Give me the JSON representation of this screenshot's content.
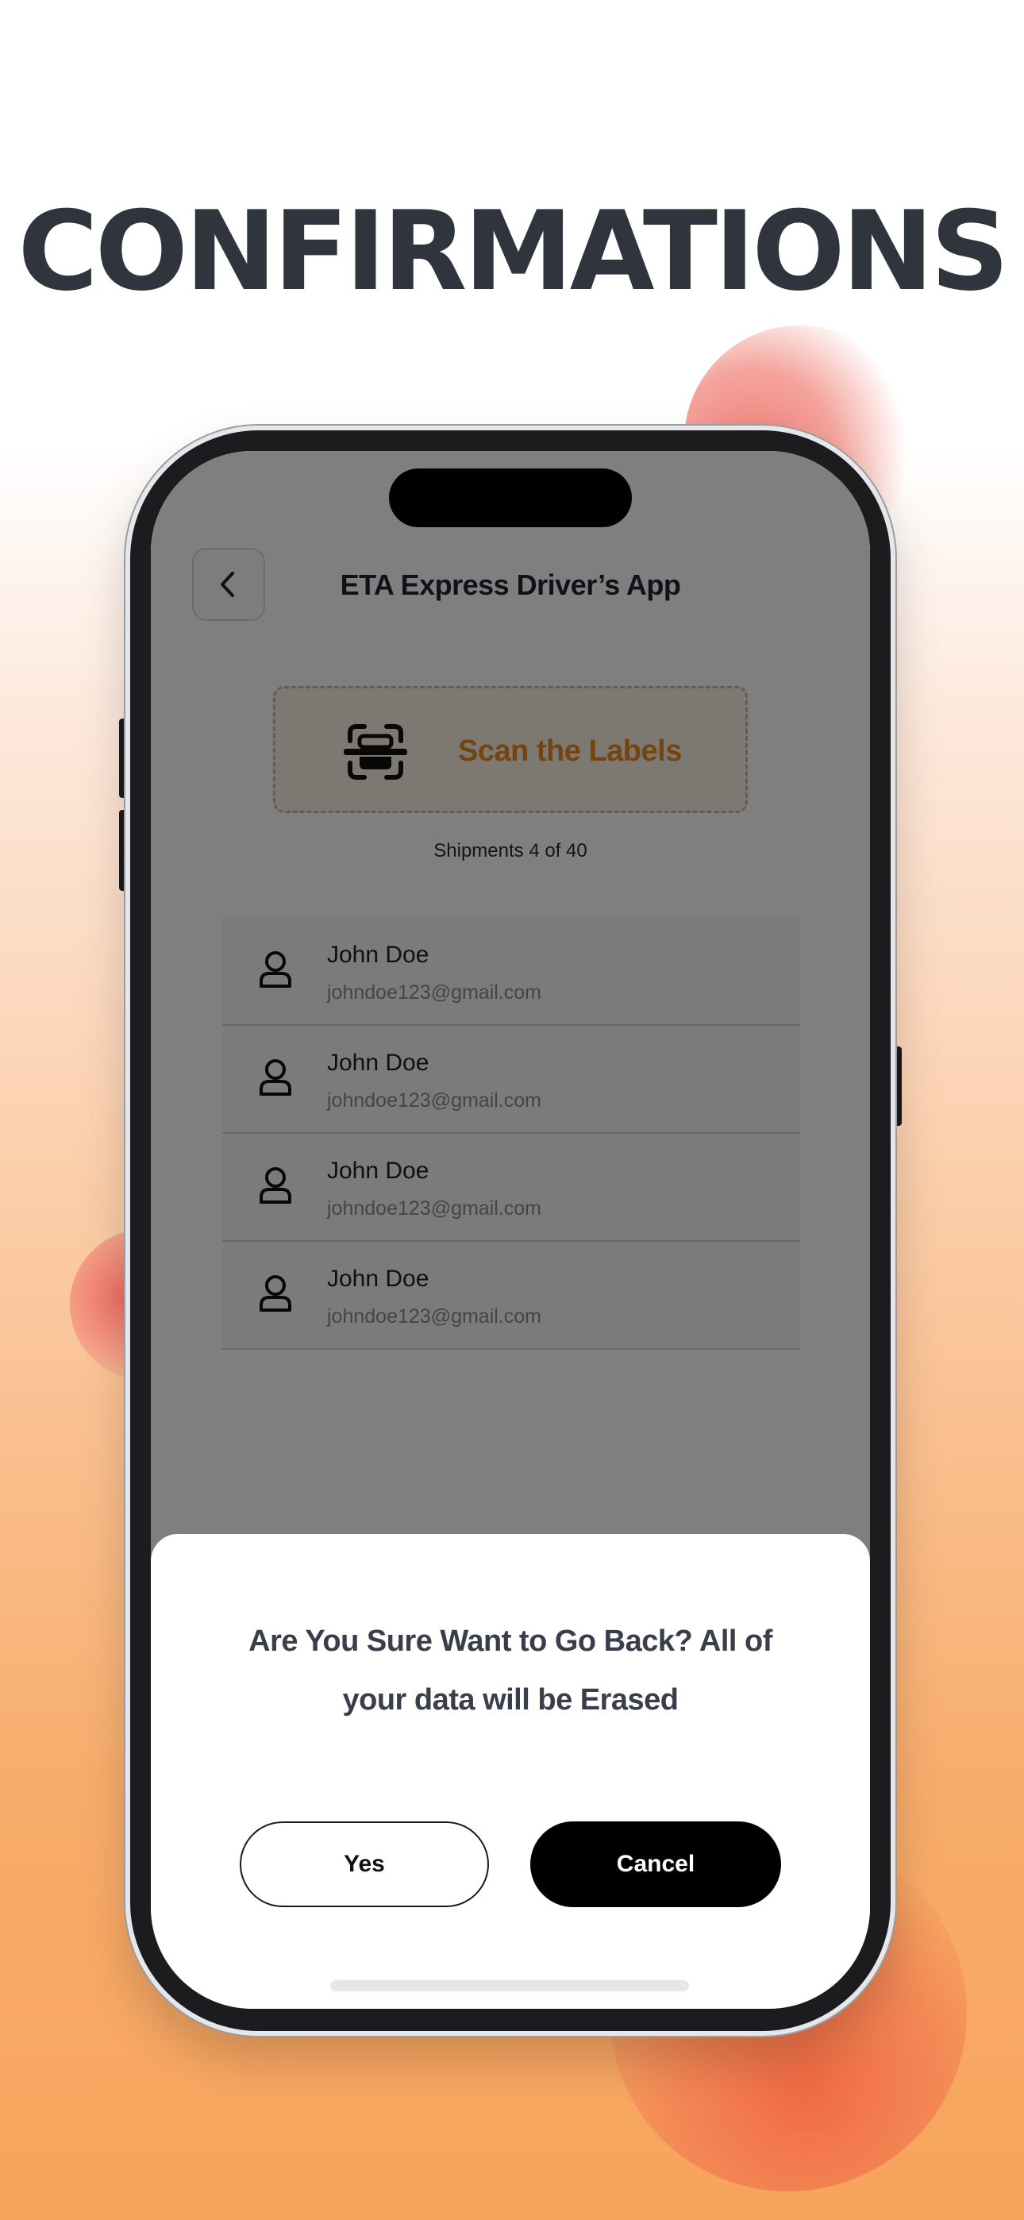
{
  "headline": "CONFIRMATIONS",
  "app": {
    "title": "ETA Express Driver’s App",
    "scan_label": "Scan the Labels",
    "shipments": "Shipments 4 of 40",
    "contacts": [
      {
        "name": "John Doe",
        "email": "johndoe123@gmail.com"
      },
      {
        "name": "John Doe",
        "email": "johndoe123@gmail.com"
      },
      {
        "name": "John Doe",
        "email": "johndoe123@gmail.com"
      },
      {
        "name": "John Doe",
        "email": "johndoe123@gmail.com"
      }
    ]
  },
  "dialog": {
    "message_line1": "Are You Sure Want to Go Back? All of",
    "message_line2": "your data will be Erased",
    "yes_label": "Yes",
    "cancel_label": "Cancel"
  },
  "colors": {
    "accent_orange": "#e88a1e",
    "headline": "#2f343d",
    "cancel_bg": "#000000"
  },
  "icons": {
    "back": "chevron-left-icon",
    "scan": "scan-label-icon",
    "contact": "user-icon"
  }
}
